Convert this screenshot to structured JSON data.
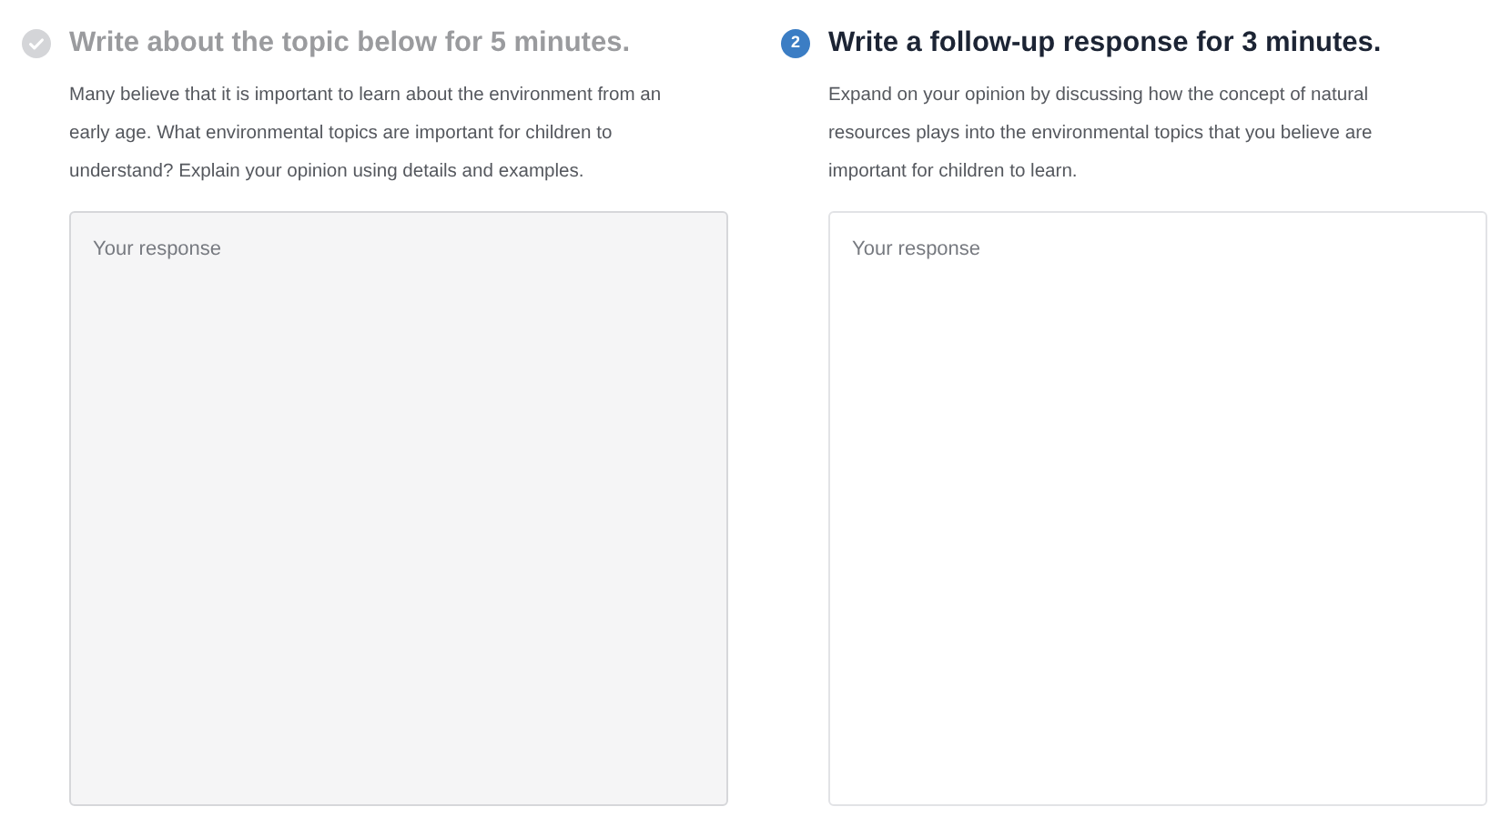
{
  "tasks": [
    {
      "kind": "done",
      "heading": "Write about the topic below for 5 minutes.",
      "prompt": "Many believe that it is important to learn about the environment from an early age. What environmental topics are important for children to understand? Explain your opinion using details and examples.",
      "response": {
        "placeholder": "Your response"
      }
    },
    {
      "kind": "current",
      "number": "2",
      "heading": "Write a follow-up response for 3 minutes.",
      "prompt": "Expand on your opinion by discussing how the concept of natural resources plays into the environmental topics that you believe are important for children to learn.",
      "response": {
        "placeholder": "Your response"
      }
    }
  ]
}
